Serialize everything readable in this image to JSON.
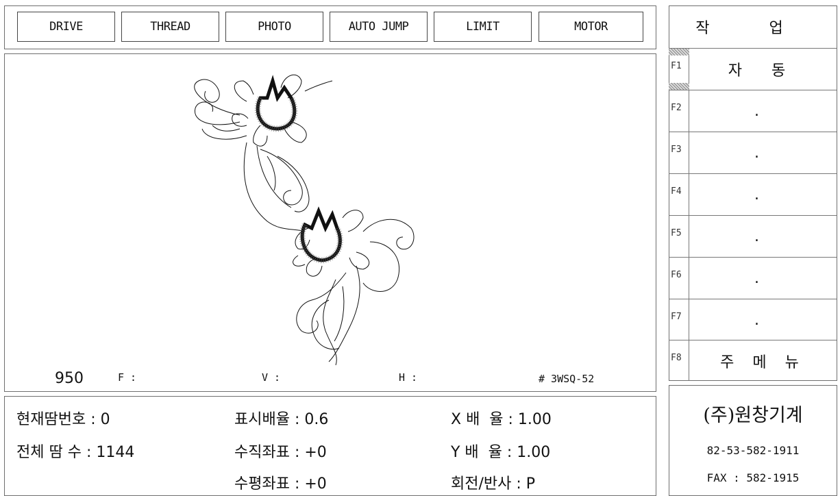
{
  "toolbar": {
    "buttons": [
      "DRIVE",
      "THREAD",
      "PHOTO",
      "AUTO JUMP",
      "LIMIT",
      "MOTOR"
    ]
  },
  "canvas": {
    "count": "950",
    "f_label": "F :",
    "v_label": "V :",
    "h_label": "H :",
    "design_id": "# 3WSQ-52"
  },
  "info": {
    "current_stitch_label": "현재땀번호 : 0",
    "total_stitch_label": "전체 땀 수 : 1144",
    "display_scale_label": "표시배율 : 0.6",
    "vertical_coord_label": "수직좌표 : +0",
    "horizontal_coord_label": "수평좌표 : +0",
    "x_scale_label": "X 배  율 : 1.00",
    "y_scale_label": "Y 배  율 : 1.00",
    "rotate_mirror_label": "회전/반사 : P"
  },
  "sidebar": {
    "title": "작 업",
    "fkeys": [
      {
        "key": "F1",
        "label": "자 동"
      },
      {
        "key": "F2",
        "label": "."
      },
      {
        "key": "F3",
        "label": "."
      },
      {
        "key": "F4",
        "label": "."
      },
      {
        "key": "F5",
        "label": "."
      },
      {
        "key": "F6",
        "label": "."
      },
      {
        "key": "F7",
        "label": "."
      },
      {
        "key": "F8",
        "label": "주 메 뉴"
      }
    ]
  },
  "company": {
    "name": "(주)원창기계",
    "phone": "82-53-582-1911",
    "fax": "FAX : 582-1915"
  },
  "colors": {
    "background": "#ffffff",
    "border": "#6e6e6e",
    "text": "#111111"
  },
  "icons": {
    "design": "embroidery-tulip-design"
  }
}
